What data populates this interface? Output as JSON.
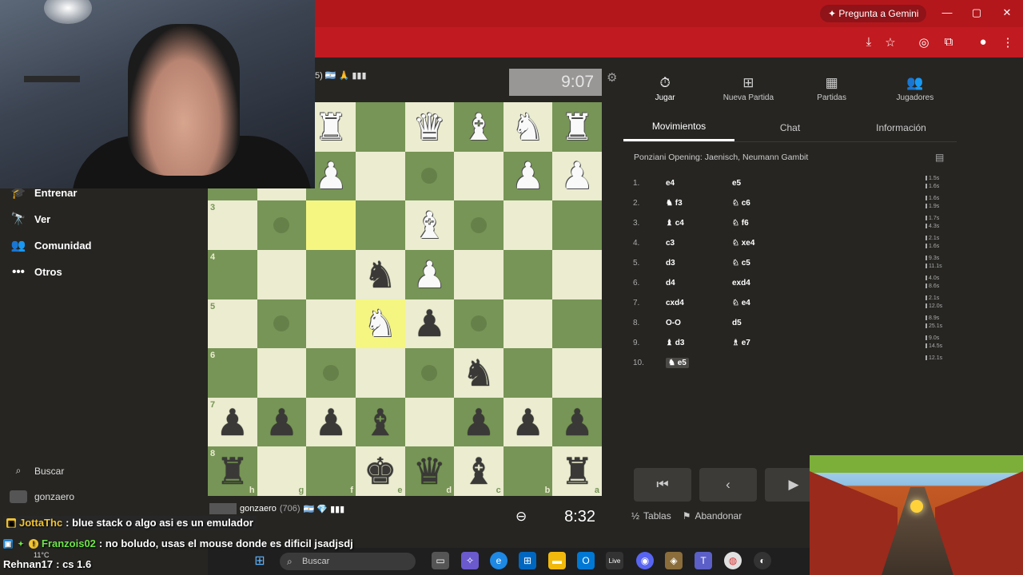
{
  "browser": {
    "gemini_label": "Pregunta a Gemini",
    "window_controls": [
      "minimize-icon",
      "maximize-icon",
      "close-icon"
    ],
    "toolbar_icons": [
      "install-icon",
      "bookmark-star-icon",
      "incognito-icon",
      "extensions-icon",
      "profile-avatar-icon",
      "menu-dots-icon"
    ]
  },
  "sidebar": {
    "items": [
      {
        "label": "Entrenar",
        "icon": "graduation-icon"
      },
      {
        "label": "Ver",
        "icon": "binoculars-icon"
      },
      {
        "label": "Comunidad",
        "icon": "people-icon"
      },
      {
        "label": "Otros",
        "icon": "more-dots-icon"
      }
    ],
    "search_label": "Buscar",
    "username": "gonzaero"
  },
  "top_player": {
    "info": "5) 🇦🇷 🙏 ▮▮▮",
    "clock": "9:07"
  },
  "bottom_player": {
    "name": "gonzaero",
    "rating": "(706)",
    "flags": "🇦🇷 💎 ▮▮▮",
    "clock": "8:32"
  },
  "board": {
    "orientation": "black",
    "ranks": [
      "1",
      "2",
      "3",
      "4",
      "5",
      "6",
      "7",
      "8"
    ],
    "files": [
      "h",
      "g",
      "f",
      "e",
      "d",
      "c",
      "b",
      "a"
    ],
    "rows": [
      [
        "",
        "",
        "R",
        "",
        "Q",
        "B",
        "N",
        "R"
      ],
      [
        "",
        "",
        "P",
        "",
        "",
        "",
        "P",
        "P"
      ],
      [
        "",
        "",
        "",
        "",
        "B",
        "",
        "",
        ""
      ],
      [
        "",
        "",
        "",
        "n",
        "P",
        "",
        "",
        ""
      ],
      [
        "",
        "",
        "",
        "N",
        "p",
        "",
        "",
        ""
      ],
      [
        "",
        "",
        "",
        "",
        "",
        "n",
        "",
        ""
      ],
      [
        "p",
        "p",
        "p",
        "b",
        "",
        "p",
        "p",
        "p"
      ],
      [
        "r",
        "",
        "",
        "k",
        "q",
        "b",
        "",
        "r"
      ]
    ],
    "highlight": [
      [
        2,
        2
      ],
      [
        4,
        3
      ]
    ],
    "dots": [
      [
        1,
        4
      ],
      [
        2,
        1
      ],
      [
        2,
        5
      ],
      [
        4,
        1
      ],
      [
        4,
        5
      ],
      [
        5,
        2
      ],
      [
        5,
        4
      ]
    ]
  },
  "panel": {
    "tabs": [
      {
        "label": "Jugar",
        "icon": "stopwatch-icon"
      },
      {
        "label": "Nueva Partida",
        "icon": "plus-square-icon"
      },
      {
        "label": "Partidas",
        "icon": "board-grid-icon"
      },
      {
        "label": "Jugadores",
        "icon": "players-icon"
      }
    ],
    "subtabs": [
      "Movimientos",
      "Chat",
      "Información"
    ],
    "opening": "Ponziani Opening: Jaenisch, Neumann Gambit",
    "moves": [
      {
        "n": "1.",
        "w": "e4",
        "wp": "",
        "b": "e5",
        "bp": "",
        "t": [
          "1.5s",
          "1.6s"
        ]
      },
      {
        "n": "2.",
        "w": "f3",
        "wp": "♞",
        "b": "c6",
        "bp": "♘",
        "t": [
          "1.6s",
          "1.9s"
        ]
      },
      {
        "n": "3.",
        "w": "c4",
        "wp": "♝",
        "b": "f6",
        "bp": "♘",
        "t": [
          "1.7s",
          "4.3s"
        ]
      },
      {
        "n": "4.",
        "w": "c3",
        "wp": "",
        "b": "xe4",
        "bp": "♘",
        "t": [
          "2.1s",
          "1.6s"
        ]
      },
      {
        "n": "5.",
        "w": "d3",
        "wp": "",
        "b": "c5",
        "bp": "♘",
        "t": [
          "9.3s",
          "11.1s"
        ]
      },
      {
        "n": "6.",
        "w": "d4",
        "wp": "",
        "b": "exd4",
        "bp": "",
        "t": [
          "4.0s",
          "8.6s"
        ]
      },
      {
        "n": "7.",
        "w": "cxd4",
        "wp": "",
        "b": "e4",
        "bp": "♘",
        "t": [
          "2.1s",
          "12.0s"
        ]
      },
      {
        "n": "8.",
        "w": "O-O",
        "wp": "",
        "b": "d5",
        "bp": "",
        "t": [
          "8.9s",
          "25.1s"
        ]
      },
      {
        "n": "9.",
        "w": "d3",
        "wp": "♝",
        "b": "e7",
        "bp": "♗",
        "t": [
          "9.0s",
          "14.5s"
        ]
      },
      {
        "n": "10.",
        "w": "e5",
        "wp": "♞",
        "b": "",
        "bp": "",
        "t": [
          "12.1s",
          ""
        ]
      }
    ],
    "draw_label": "Tablas",
    "resign_label": "Abandonar"
  },
  "chat": [
    {
      "user": "JottaThc",
      "msg": ": blue stack o algo asi es un emulador"
    },
    {
      "user": "Franzois02",
      "msg": ": no boludo, usas el mouse donde es dificil jsadjsdj"
    },
    {
      "user": "Rehnan17",
      "msg": ": cs 1.6"
    }
  ],
  "taskbar": {
    "search_label": "Buscar",
    "weather": "11°C"
  }
}
